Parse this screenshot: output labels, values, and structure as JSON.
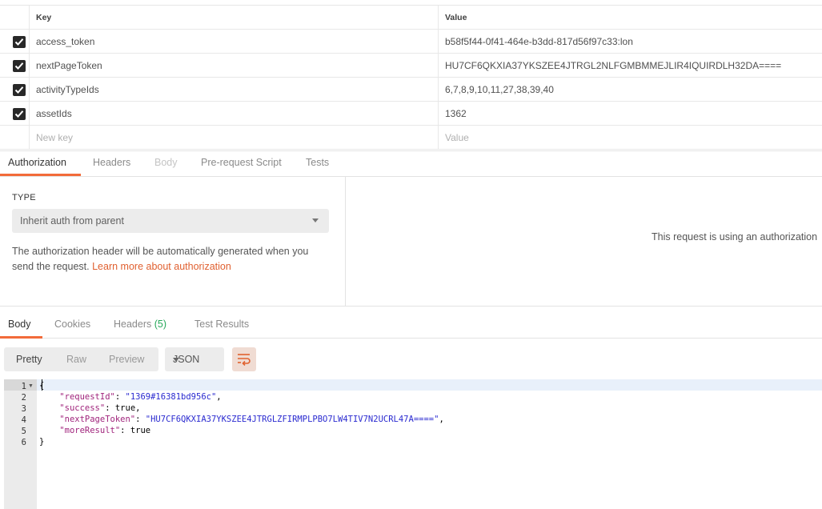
{
  "params": {
    "columns": {
      "key": "Key",
      "value": "Value"
    },
    "rows": [
      {
        "checked": true,
        "key": "access_token",
        "value": "b58f5f44-0f41-464e-b3dd-817d56f97c33:lon"
      },
      {
        "checked": true,
        "key": "nextPageToken",
        "value": "HU7CF6QKXIA37YKSZEE4JTRGL2NLFGMBMMEJLIR4IQUIRDLH32DA===="
      },
      {
        "checked": true,
        "key": "activityTypeIds",
        "value": "6,7,8,9,10,11,27,38,39,40"
      },
      {
        "checked": true,
        "key": "assetIds",
        "value": "1362"
      }
    ],
    "new_key_placeholder": "New key",
    "new_value_placeholder": "Value"
  },
  "request_tabs": [
    {
      "label": "Authorization",
      "active": true
    },
    {
      "label": "Headers",
      "active": false
    },
    {
      "label": "Body",
      "active": false,
      "disabled": true
    },
    {
      "label": "Pre-request Script",
      "active": false
    },
    {
      "label": "Tests",
      "active": false
    }
  ],
  "auth": {
    "type_label": "TYPE",
    "type_value": "Inherit auth from parent",
    "description": "The authorization header will be automatically generated when you send the request.",
    "learn_more": "Learn more about authorization",
    "right_text": "This request is using an authorization"
  },
  "response_tabs": [
    {
      "label": "Body",
      "active": true
    },
    {
      "label": "Cookies",
      "active": false
    },
    {
      "label": "Headers",
      "count": "(5)",
      "active": false
    },
    {
      "label": "Test Results",
      "active": false
    }
  ],
  "toolbar": {
    "view_modes": [
      "Pretty",
      "Raw",
      "Preview"
    ],
    "format": "JSON",
    "wrap_icon": "wrap-lines-icon"
  },
  "editor": {
    "line_numbers": [
      "1",
      "2",
      "3",
      "4",
      "5",
      "6"
    ],
    "lines": {
      "l1": "{",
      "l2_key": "\"requestId\"",
      "l2_val": "\"1369#16381bd956c\"",
      "l3_key": "\"success\"",
      "l3_val": "true",
      "l4_key": "\"nextPageToken\"",
      "l4_val": "\"HU7CF6QKXIA37YKSZEE4JTRGLZFIRMPLPBO7LW4TIV7N2UCRL47A====\"",
      "l5_key": "\"moreResult\"",
      "l5_val": "true",
      "l6": "}"
    }
  },
  "colors": {
    "accent": "#f26b3a",
    "link": "#e06030",
    "count": "#27a85a",
    "json_key": "#a0247c",
    "json_string": "#2a2ad0"
  }
}
